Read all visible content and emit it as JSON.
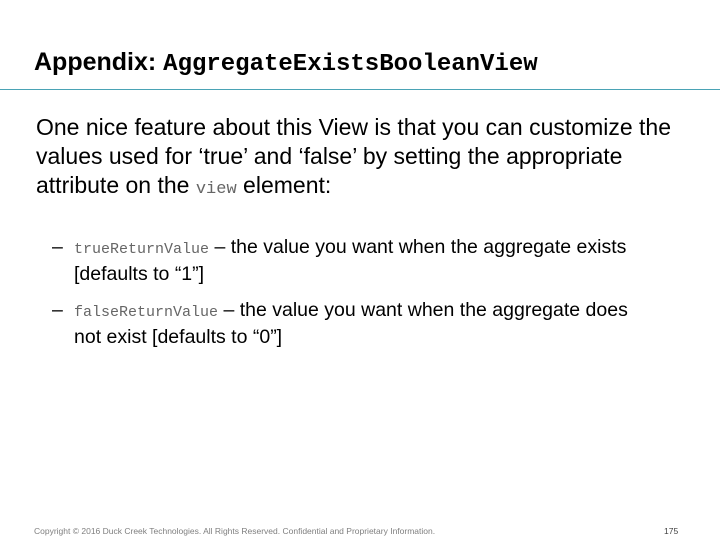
{
  "title": {
    "prefix": "Appendix: ",
    "code": "AggregateExistsBooleanView"
  },
  "intro": {
    "part1": "One nice feature about this View is that you can customize the values used for ‘true’ and ‘false’ by setting the appropriate attribute on the ",
    "code": "view",
    "part2": " element:"
  },
  "bullets": [
    {
      "dash": "–",
      "code": "trueReturnValue",
      "text": " – the value you want when the aggregate exists [defaults to “1”]"
    },
    {
      "dash": "–",
      "code": "falseReturnValue",
      "text": " – the value you want when the aggregate does not exist [defaults to “0”]"
    }
  ],
  "footer": {
    "copyright": "Copyright © 2016 Duck Creek Technologies. All Rights Reserved. Confidential and Proprietary Information.",
    "page_number": "175"
  },
  "colors": {
    "rule": "#4aa3b5",
    "code_text": "#666666",
    "footer_text": "#7f7f7f"
  }
}
